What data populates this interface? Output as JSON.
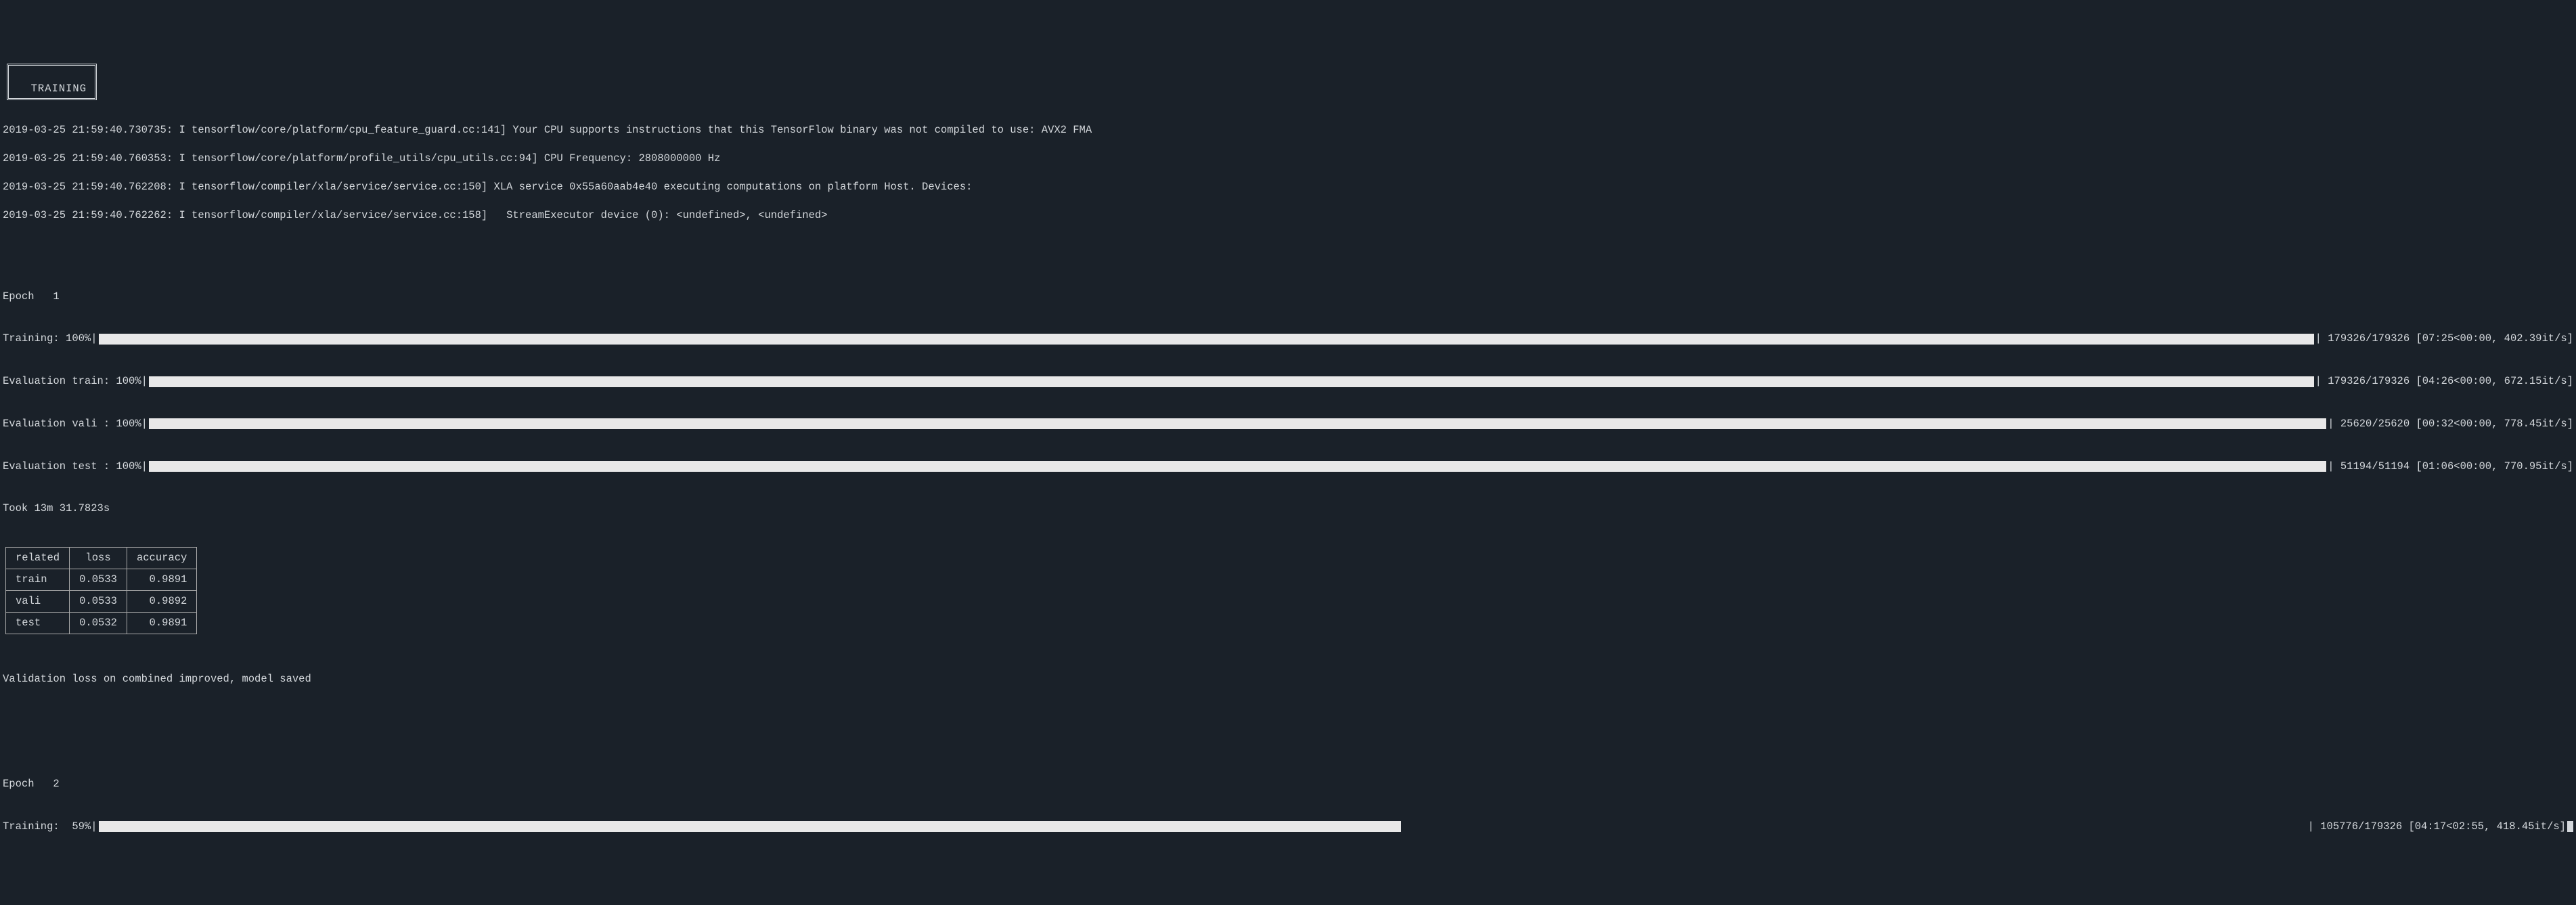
{
  "title": "TRAINING",
  "log_lines": [
    "2019-03-25 21:59:40.730735: I tensorflow/core/platform/cpu_feature_guard.cc:141] Your CPU supports instructions that this TensorFlow binary was not compiled to use: AVX2 FMA",
    "2019-03-25 21:59:40.760353: I tensorflow/core/platform/profile_utils/cpu_utils.cc:94] CPU Frequency: 2808000000 Hz",
    "2019-03-25 21:59:40.762208: I tensorflow/compiler/xla/service/service.cc:150] XLA service 0x55a60aab4e40 executing computations on platform Host. Devices:",
    "2019-03-25 21:59:40.762262: I tensorflow/compiler/xla/service/service.cc:158]   StreamExecutor device (0): <undefined>, <undefined>"
  ],
  "epoch1": {
    "label": "Epoch   1",
    "training": {
      "label": "Training: 100%|",
      "percent": 100,
      "stats": "| 179326/179326 [07:25<00:00, 402.39it/s]"
    },
    "eval_train": {
      "label": "Evaluation train: 100%|",
      "percent": 100,
      "stats": "| 179326/179326 [04:26<00:00, 672.15it/s]"
    },
    "eval_vali": {
      "label": "Evaluation vali : 100%|",
      "percent": 100,
      "stats": "| 25620/25620 [00:32<00:00, 778.45it/s]"
    },
    "eval_test": {
      "label": "Evaluation test : 100%|",
      "percent": 100,
      "stats": "| 51194/51194 [01:06<00:00, 770.95it/s]"
    },
    "took": "Took 13m 31.7823s"
  },
  "table": {
    "headers": [
      "related",
      "loss",
      "accuracy"
    ],
    "rows": [
      [
        "train",
        "0.0533",
        "0.9891"
      ],
      [
        "vali",
        "0.0533",
        "0.9892"
      ],
      [
        "test",
        "0.0532",
        "0.9891"
      ]
    ]
  },
  "validation_msg": "Validation loss on combined improved, model saved",
  "epoch2": {
    "label": "Epoch   2",
    "training": {
      "label": "Training:  59%|",
      "percent": 59,
      "stats": "| 105776/179326 [04:17<02:55, 418.45it/s]"
    }
  }
}
